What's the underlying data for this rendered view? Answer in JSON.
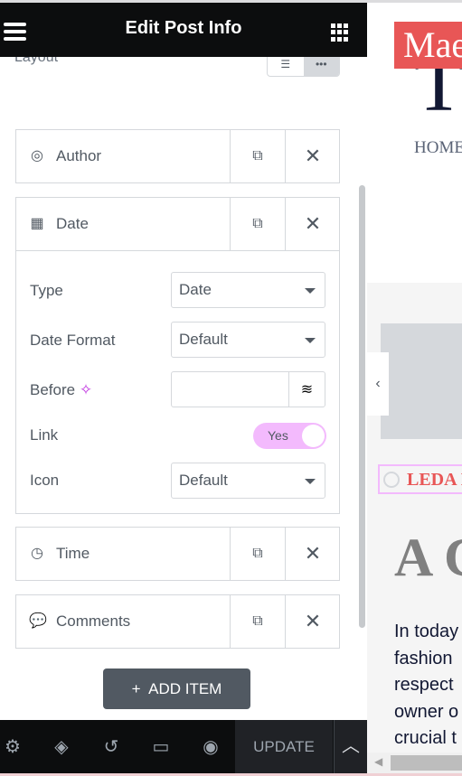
{
  "header": {
    "title": "Edit Post Info",
    "menu_icon": "hamburger-icon",
    "apps_icon": "grid-icon"
  },
  "layout": {
    "label": "Layout",
    "options": [
      "list",
      "inline"
    ],
    "selected": "inline"
  },
  "items": [
    {
      "label": "Author",
      "icon": "user-circle-icon"
    },
    {
      "label": "Date",
      "icon": "calendar-icon"
    },
    {
      "label": "Time",
      "icon": "clock-icon"
    },
    {
      "label": "Comments",
      "icon": "comment-icon"
    }
  ],
  "date_settings": {
    "type_label": "Type",
    "type_value": "Date",
    "format_label": "Date Format",
    "format_value": "Default",
    "before_label": "Before",
    "before_value": "",
    "link_label": "Link",
    "link_value": "Yes",
    "icon_label": "Icon",
    "icon_value": "Default"
  },
  "add_item": {
    "plus": "+",
    "label": "ADD ITEM"
  },
  "footer": {
    "update": "UPDATE"
  },
  "preview": {
    "logo": "Mae",
    "big_letter": "T",
    "nav": "HOME",
    "author": "LEDA I",
    "headline": "A C",
    "body_lines": [
      "In today",
      "fashion",
      "respect",
      "owner o",
      "crucial t"
    ]
  },
  "colors": {
    "accent": "#f3bafd",
    "brand_red": "#e85656",
    "dark": "#0c0d0e"
  }
}
